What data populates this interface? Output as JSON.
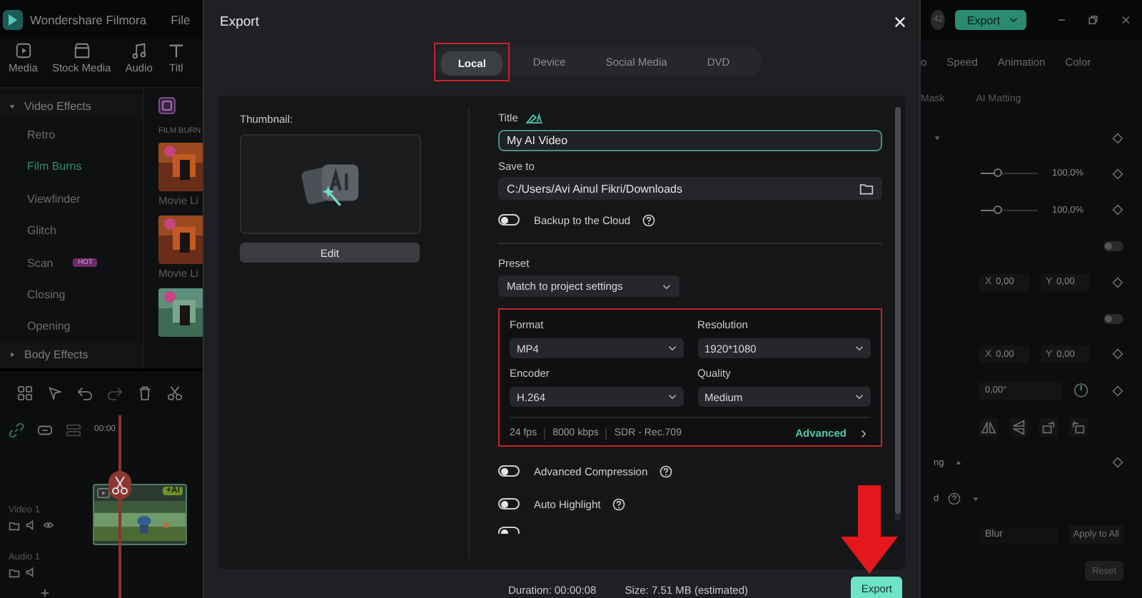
{
  "app_bar": {
    "app_name": "Wondershare Filmora",
    "menu": [
      "File"
    ],
    "badge": "42",
    "export_button": "Export"
  },
  "media_toolbar": [
    {
      "label": "Media",
      "kind": "media"
    },
    {
      "label": "Stock Media",
      "kind": "stock"
    },
    {
      "label": "Audio",
      "kind": "audio"
    },
    {
      "label": "Titl",
      "kind": "title"
    }
  ],
  "effects_sidebar": {
    "groups": [
      {
        "label": "Video Effects",
        "expanded": true,
        "children": [
          {
            "label": "Retro",
            "selected": false
          },
          {
            "label": "Film Burns",
            "selected": true
          },
          {
            "label": "Viewfinder",
            "selected": false
          },
          {
            "label": "Glitch",
            "selected": false
          },
          {
            "label": "Scan",
            "selected": false,
            "badge": "HOT"
          },
          {
            "label": "Closing",
            "selected": false
          },
          {
            "label": "Opening",
            "selected": false
          }
        ]
      },
      {
        "label": "Body Effects",
        "expanded": false
      }
    ]
  },
  "effects_grid": {
    "heading": "FILM BURN",
    "items": [
      {
        "kind": "picture",
        "label": "Movie Li"
      },
      {
        "kind": "picture",
        "label": "Movie Li"
      },
      {
        "kind": "picture"
      }
    ]
  },
  "timeline": {
    "ruler_time": "00:00",
    "clip_badge": "+AI",
    "tracks": [
      {
        "name": "Video 1",
        "kind": "video"
      },
      {
        "name": "Audio 1",
        "kind": "audio"
      }
    ]
  },
  "properties_panel": {
    "tabs": [
      "o",
      "Speed",
      "Animation",
      "Color"
    ],
    "subtabs": [
      "Mask",
      "AI Matting"
    ],
    "rows": [
      {
        "kind": "header"
      },
      {
        "kind": "slider",
        "level": 0.29,
        "reading": "100,0%"
      },
      {
        "kind": "slider",
        "level": 0.29,
        "reading": "100,0%"
      },
      {
        "kind": "toggle",
        "on": false
      },
      {
        "kind": "xy",
        "fields": [
          {
            "label": "X",
            "value": "0,00"
          },
          {
            "label": "Y",
            "value": "0,00"
          }
        ]
      },
      {
        "kind": "toggle",
        "on": false
      },
      {
        "kind": "xy",
        "fields": [
          {
            "label": "X",
            "value": "0,00"
          },
          {
            "label": "Y",
            "value": "0,00"
          }
        ]
      },
      {
        "kind": "angle",
        "value": "0,00°"
      },
      {
        "kind": "icons"
      },
      {
        "kind": "section",
        "label": "ng"
      },
      {
        "kind": "section_help",
        "label": "d"
      },
      {
        "kind": "dropdown",
        "value": "Blur",
        "button": "Apply to All"
      },
      {
        "kind": "reset",
        "button": "Reset"
      }
    ]
  },
  "export_dialog": {
    "title": "Export",
    "tabs": [
      {
        "label": "Local",
        "selected": true
      },
      {
        "label": "Device",
        "selected": false
      },
      {
        "label": "Social Media",
        "selected": false
      },
      {
        "label": "DVD",
        "selected": false
      }
    ],
    "thumbnail": {
      "label": "Thumbnail:",
      "edit_button": "Edit"
    },
    "title_field": {
      "label": "Title",
      "value": "My AI Video"
    },
    "save_to": {
      "label": "Save to",
      "value": "C:/Users/Avi Ainul Fikri/Downloads"
    },
    "cloud_backup": {
      "label": "Backup to the Cloud",
      "on": false
    },
    "preset": {
      "label": "Preset",
      "value": "Match to project settings"
    },
    "settings": {
      "fields": [
        {
          "label": "Format",
          "value": "MP4"
        },
        {
          "label": "Resolution",
          "value": "1920*1080"
        },
        {
          "label": "Encoder",
          "value": "H.264"
        },
        {
          "label": "Quality",
          "value": "Medium"
        }
      ],
      "specs": [
        "24 fps",
        "8000 kbps",
        "SDR - Rec.709"
      ],
      "advanced_link": "Advanced"
    },
    "options": [
      {
        "label": "Advanced Compression",
        "on": false
      },
      {
        "label": "Auto Highlight",
        "on": false
      }
    ],
    "duration": "Duration: 00:00:08",
    "size": "Size: 7.51 MB (estimated)",
    "export_button": "Export"
  }
}
